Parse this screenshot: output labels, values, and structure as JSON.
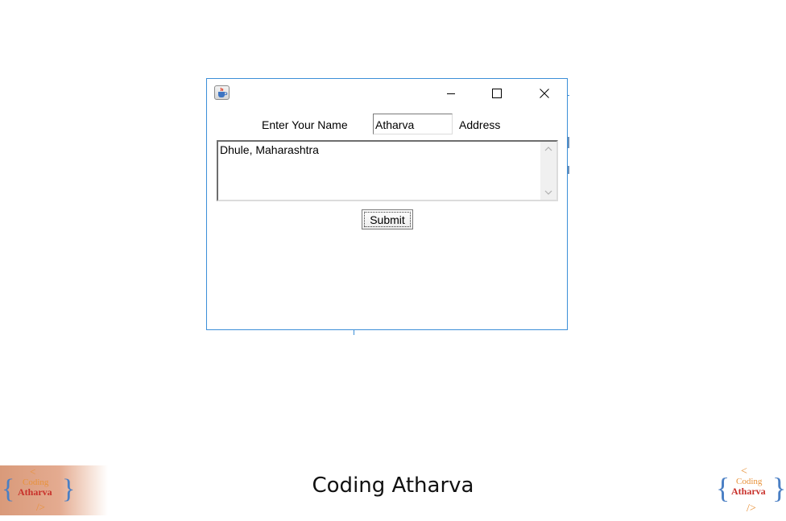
{
  "window": {
    "app_icon": "java-coffee-cup-icon",
    "minimize_icon": "minimize-icon",
    "maximize_icon": "maximize-icon",
    "close_icon": "close-icon"
  },
  "form": {
    "name_label": "Enter Your Name",
    "name_value": "Atharva",
    "address_label": "Address",
    "address_value": "Dhule, Maharashtra",
    "submit_label": "Submit"
  },
  "footer": {
    "title": "Coding Atharva",
    "logo_text_top": "Coding",
    "logo_text_main": "Atharva",
    "logo_lt": "<",
    "logo_gt": "/>",
    "logo_brace_left": "{",
    "logo_brace_right": "}"
  },
  "colors": {
    "window_border": "#3c8fd8",
    "logo_orange": "#e8923a",
    "logo_red": "#c8302a",
    "logo_blue": "#4a7fc4"
  }
}
